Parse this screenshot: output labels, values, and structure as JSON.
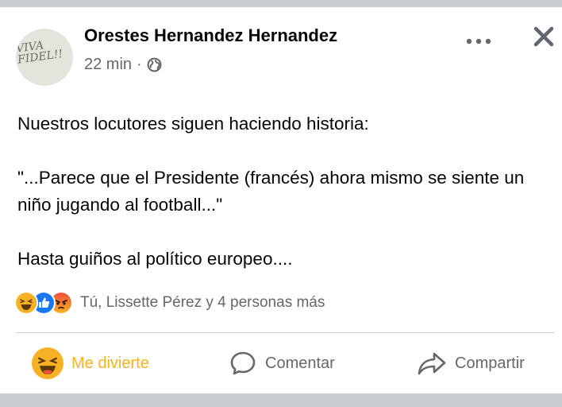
{
  "post": {
    "author": "Orestes Hernandez Hernandez",
    "avatar_text": "VIVA FIDEL!!",
    "time": "22 min",
    "separator": "·",
    "privacy_icon": "globe-icon",
    "paragraphs": [
      "Nuestros locutores siguen haciendo historia:",
      "\"...Parece que el Presidente  (francés) ahora mismo se siente un niño jugando al football...\"",
      "Hasta guiños al político europeo...."
    ]
  },
  "reactions": {
    "icons": [
      "haha-icon",
      "like-icon",
      "angry-icon"
    ],
    "summary": "Tú, Lissette Pérez y 4 personas más"
  },
  "actions": {
    "react_label": "Me divierte",
    "comment_label": "Comentar",
    "share_label": "Compartir"
  },
  "colors": {
    "haha": "#f7b125",
    "like": "#1877f2",
    "angry": "#e9710f",
    "secondary_text": "#65676b"
  }
}
